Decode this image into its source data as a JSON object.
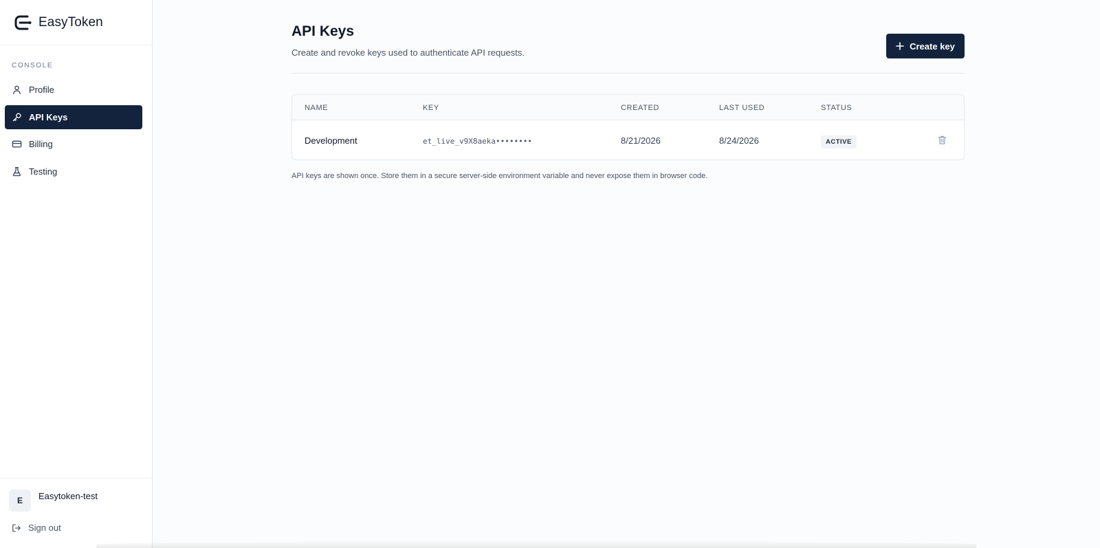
{
  "brand": {
    "name": "EasyToken"
  },
  "sidebar": {
    "section_label": "CONSOLE",
    "items": [
      {
        "label": "Profile",
        "icon": "user-icon",
        "active": false
      },
      {
        "label": "API Keys",
        "icon": "key-icon",
        "active": true
      },
      {
        "label": "Billing",
        "icon": "credit-card-icon",
        "active": false
      },
      {
        "label": "Testing",
        "icon": "flask-icon",
        "active": false
      }
    ],
    "user": {
      "initial": "E",
      "name": "Easytoken-test"
    },
    "sign_out_label": "Sign out"
  },
  "header": {
    "title": "API Keys",
    "subtitle": "Create and revoke keys used to authenticate API requests.",
    "create_button_label": "Create key"
  },
  "table": {
    "columns": [
      "NAME",
      "KEY",
      "CREATED",
      "LAST USED",
      "STATUS"
    ],
    "rows": [
      {
        "name": "Development",
        "key": "et_live_v9X8aeka••••••••",
        "created": "8/21/2026",
        "last_used": "8/24/2026",
        "status": "ACTIVE"
      }
    ]
  },
  "note": "API keys are shown once. Store them in a secure server-side environment variable and never expose them in browser code.",
  "colors": {
    "primary": "#13233d",
    "border": "#e5e7eb",
    "background": "#fbfcfd"
  }
}
